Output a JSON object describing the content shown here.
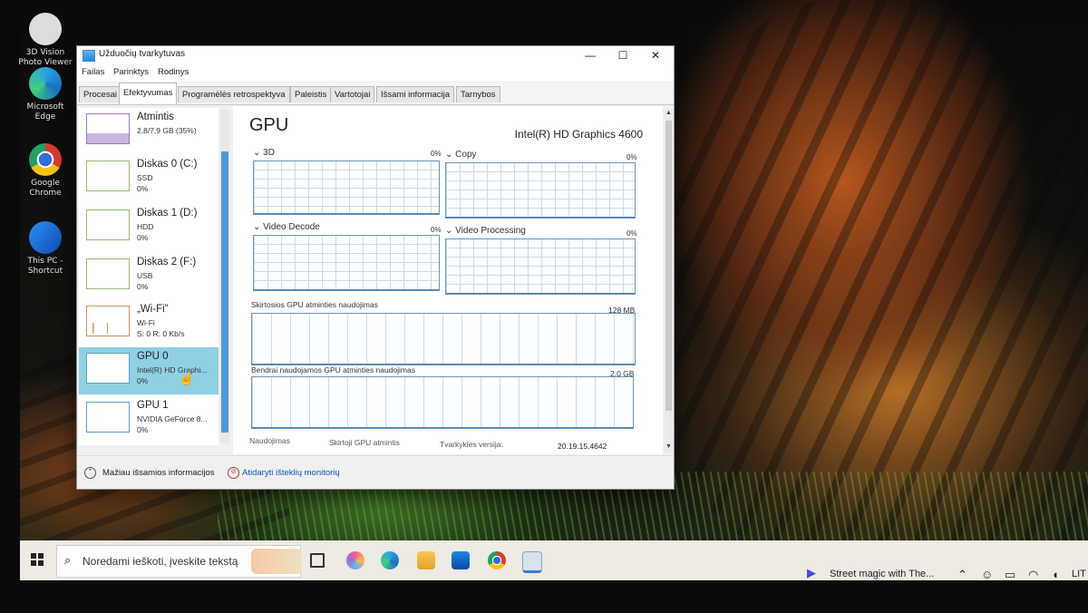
{
  "desktop": {
    "icons": [
      {
        "label": "3D Vision\nPhoto Viewer",
        "icon": "3d-vision-icon"
      },
      {
        "label": "Microsoft\nEdge",
        "icon": "edge-icon"
      },
      {
        "label": "Google\nChrome",
        "icon": "chrome-icon"
      },
      {
        "label": "This PC -\nShortcut",
        "icon": "this-pc-icon"
      }
    ]
  },
  "window": {
    "title": "Užduočių tvarkytuvas",
    "controls": {
      "minimize": "—",
      "maximize": "☐",
      "close": "✕"
    },
    "menu": [
      "Failas",
      "Parinktys",
      "Rodinys"
    ],
    "tabs": [
      "Procesai",
      "Efektyvumas",
      "Programėlės retrospektyva",
      "Paleistis",
      "Vartotojai",
      "Išsami informacija",
      "Tarnybos"
    ],
    "active_tab": "Efektyvumas",
    "sidebar": [
      {
        "name": "Atmintis",
        "sub": "2,8/7,9 GB (35%)",
        "value": "",
        "kind": "mem"
      },
      {
        "name": "Diskas 0 (C:)",
        "sub": "SSD",
        "value": "0%",
        "kind": "disk"
      },
      {
        "name": "Diskas 1 (D:)",
        "sub": "HDD",
        "value": "0%",
        "kind": "disk"
      },
      {
        "name": "Diskas 2 (F:)",
        "sub": "USB",
        "value": "0%",
        "kind": "disk"
      },
      {
        "name": "„Wi-Fi\"",
        "sub": "Wi-Fi",
        "value": "S: 0 R: 0 Kb/s",
        "kind": "net"
      },
      {
        "name": "GPU 0",
        "sub": "Intel(R) HD Graphi...",
        "value": "0%",
        "kind": "gpu",
        "selected": true
      },
      {
        "name": "GPU 1",
        "sub": "NVIDIA GeForce 8...",
        "value": "0%",
        "kind": "gpu"
      }
    ],
    "main": {
      "title": "GPU",
      "model": "Intel(R) HD Graphics 4600",
      "graphs": [
        {
          "label": "3D",
          "pct": "0%"
        },
        {
          "label": "Copy",
          "pct": "0%"
        },
        {
          "label": "Video Decode",
          "pct": "0%"
        },
        {
          "label": "Video Processing",
          "pct": "0%"
        }
      ],
      "dedicated_label": "Skirtosios GPU atminties naudojimas",
      "dedicated_max": "128 MB",
      "shared_label": "Bendrai naudojamos GPU atminties naudojimas",
      "shared_max": "2,0 GB",
      "stats": {
        "usage_label": "Naudojimas",
        "dedicated_mem_label": "Skirtoji GPU atmintis",
        "driver_label": "Tvarkyklės versija:",
        "driver_value": "20.19.15.4642"
      }
    },
    "footer": {
      "less_details": "Mažiau išsamios informacijos",
      "open_monitor": "Atidaryti išteklių monitorių"
    }
  },
  "taskbar": {
    "search_placeholder": "Noredami ieškoti, įveskite tekstą",
    "apps": [
      "task-view-icon",
      "copilot-icon",
      "edge-icon",
      "file-explorer-icon",
      "mail-icon",
      "chrome-icon",
      "task-manager-icon"
    ],
    "media_title": "Street magic with The...",
    "tray": [
      "chevron-up-icon",
      "people-icon",
      "battery-icon",
      "wifi-icon",
      "volume-icon"
    ],
    "lang": "LIT"
  }
}
